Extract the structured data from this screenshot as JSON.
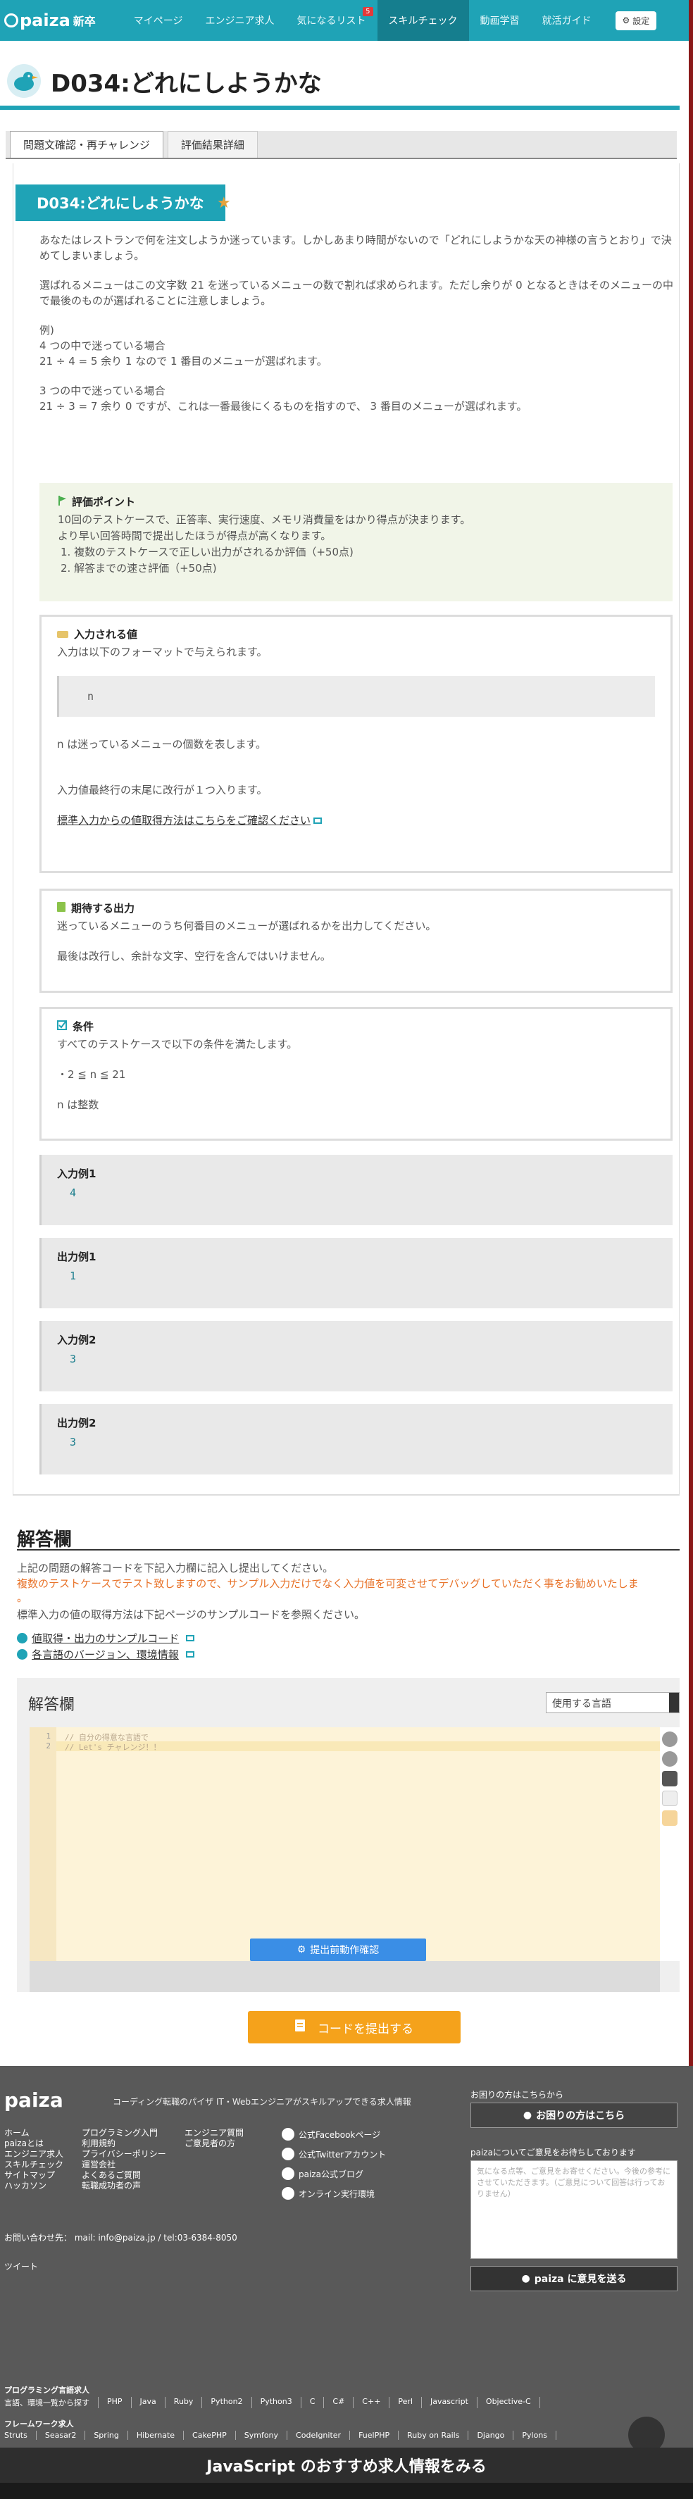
{
  "nav": {
    "logo": "paiza",
    "logo_sub": "新卒",
    "items": [
      "マイページ",
      "エンジニア求人",
      "気になるリスト",
      "スキルチェック",
      "動画学習",
      "就活ガイド"
    ],
    "badge_count": "5",
    "settings": "設定"
  },
  "header": {
    "title": "D034:どれにしようかな"
  },
  "tabs": [
    "問題文確認・再チャレンジ",
    "評価結果詳細"
  ],
  "problem": {
    "ribbon": "D034:どれにしようかな",
    "desc": [
      "あなたはレストランで何を注文しようか迷っています。しかしあまり時間がないので「どれにしようかな天の神様の言うとおり」で決めてしまいましょう。",
      "選ばれるメニューはこの文字数 21 を迷っているメニューの数で割れば求められます。ただし余りが 0 となるときはそのメニューの中で最後のものが選ばれることに注意しましょう。",
      "例)\n4 つの中で迷っている場合\n21 ÷ 4 = 5 余り 1 なので 1 番目のメニューが選ばれます。",
      "3 つの中で迷っている場合\n21 ÷ 3 = 7 余り 0 ですが、これは一番最後にくるものを指すので、 3 番目のメニューが選ばれます。"
    ]
  },
  "eval": {
    "title": "評価ポイント",
    "lines": [
      "10回のテストケースで、正答率、実行速度、メモリ消費量をはかり得点が決まります。",
      "より早い回答時間で提出したほうが得点が高くなります。",
      "1. 複数のテストケースで正しい出力がされるか評価（+50点)",
      "2. 解答までの速さ評価（+50点)"
    ]
  },
  "input_sec": {
    "title": "入力される値",
    "line1": "入力は以下のフォーマットで与えられます。",
    "code": "n",
    "line2": "n は迷っているメニューの個数を表します。",
    "line3": "入力値最終行の末尾に改行が１つ入ります。",
    "link": "標準入力からの値取得方法はこちらをご確認ください"
  },
  "output_sec": {
    "title": "期待する出力",
    "line1": "迷っているメニューのうち何番目のメニューが選ばれるかを出力してください。",
    "line2": "最後は改行し、余計な文字、空行を含んではいけません。"
  },
  "cond_sec": {
    "title": "条件",
    "line1": "すべてのテストケースで以下の条件を満たします。",
    "line2": "・2 ≦ n ≦ 21",
    "line3": "n は整数"
  },
  "examples": [
    {
      "title": "入力例1",
      "value": "4"
    },
    {
      "title": "出力例1",
      "value": "1"
    },
    {
      "title": "入力例2",
      "value": "3"
    },
    {
      "title": "出力例2",
      "value": "3"
    }
  ],
  "answer": {
    "title": "解答欄",
    "line1": "上記の問題の解答コードを下記入力欄に記入し提出してください。",
    "line2": "複数のテストケースでテスト致しますので、サンプル入力だけでなく入力値を可変させてデバッグしていただく事をお勧めいたしま",
    "line3": "。",
    "line4": "標準入力の値の取得方法は下記ページのサンプルコードを参照ください。",
    "link1": "値取得・出力のサンプルコード",
    "link2": "各言語のバージョン、環境情報"
  },
  "editor": {
    "title": "解答欄",
    "lang_placeholder": "使用する言語",
    "lines": [
      "// 自分の得意な言語で",
      "// Let's チャレンジ！！"
    ],
    "line_numbers": [
      "1",
      "2"
    ],
    "run_button": "提出前動作確認"
  },
  "submit": {
    "label": "コードを提出する"
  },
  "footer": {
    "logo": "paiza",
    "tagline": "コーディング転職のパイザ  IT・Webエンジニアがスキルアップできる求人情報",
    "col1": [
      "ホーム",
      "paizaとは",
      "エンジニア求人",
      "スキルチェック",
      "サイトマップ",
      "ハッカソン"
    ],
    "col2": [
      "プログラミング入門",
      "利用規約",
      "プライバシーポリシー",
      "運営会社",
      "よくあるご質問",
      "転職成功者の声"
    ],
    "col3": [
      "エンジニア質問",
      "ご意見者の方"
    ],
    "social": [
      "公式Facebookページ",
      "公式Twitterアカウント",
      "paiza公式ブログ",
      "オンライン実行環境"
    ],
    "help_label": "お困りの方はこちらから",
    "help_button": "お困りの方はこちら",
    "feed_label": "paizaについてご意見をお待ちしております",
    "feed_placeholder": "気になる点等、ご意見をお寄せください。今後の参考にさせていただきます。（ご意見について回答は行っておりません）",
    "send_button": "paiza に意見を送る",
    "contact": "お問い合わせ先： mail: info@paiza.jp  / tel:03-6384-8050",
    "tweet": "ツイート",
    "prog_title": "プログラミング言語求人",
    "prog_links": [
      "言語、環境一覧から探す",
      "PHP",
      "Java",
      "Ruby",
      "Python2",
      "Python3",
      "C",
      "C#",
      "C++",
      "Perl",
      "Javascript",
      "Objective-C"
    ],
    "fw_title": "フレームワーク求人",
    "fw_links": [
      "Struts",
      "Seasar2",
      "Spring",
      "Hibernate",
      "CakePHP",
      "Symfony",
      "CodeIgniter",
      "FuelPHP",
      "Ruby on Rails",
      "Django",
      "Pylons"
    ],
    "job_bar": "JavaScript のおすすめ求人情報をみる"
  }
}
